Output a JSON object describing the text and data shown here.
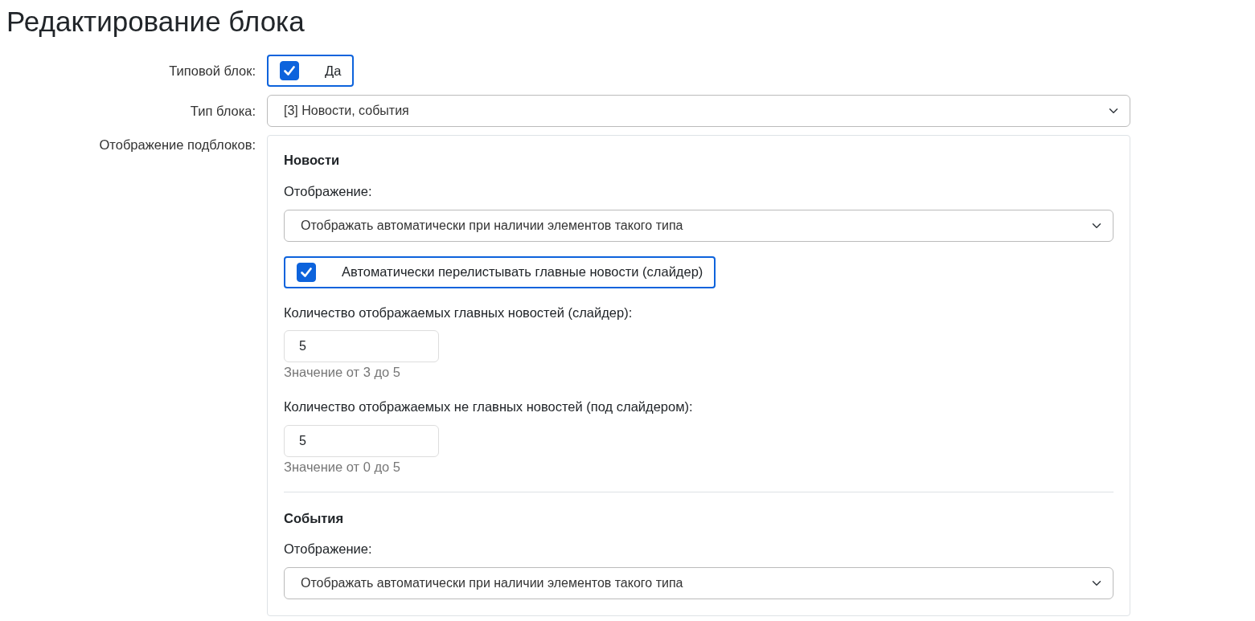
{
  "title": "Редактирование блока",
  "fields": [
    {
      "kind": "checkbox",
      "label": "Типовой блок:",
      "text": "Да",
      "checked": true
    },
    {
      "kind": "select",
      "label": "Тип блока:",
      "value": "[3] Новости, события"
    },
    {
      "kind": "panel",
      "label": "Отображение подблоков:",
      "sections": [
        {
          "heading": "Новости",
          "controls": [
            {
              "kind": "select",
              "label": "Отображение:",
              "value": "Отображать автоматически при наличии элементов такого типа"
            },
            {
              "kind": "checkbox",
              "text": "Автоматически перелистывать главные новости (слайдер)",
              "checked": true
            },
            {
              "kind": "number",
              "label": "Количество отображаемых главных новостей (слайдер):",
              "value": "5",
              "hint": "Значение от 3 до 5"
            },
            {
              "kind": "number",
              "label": "Количество отображаемых не главных новостей (под слайдером):",
              "value": "5",
              "hint": "Значение от 0 до 5"
            }
          ]
        },
        {
          "heading": "События",
          "controls": [
            {
              "kind": "select",
              "label": "Отображение:",
              "value": "Отображать автоматически при наличии элементов такого типа"
            }
          ]
        }
      ]
    }
  ]
}
